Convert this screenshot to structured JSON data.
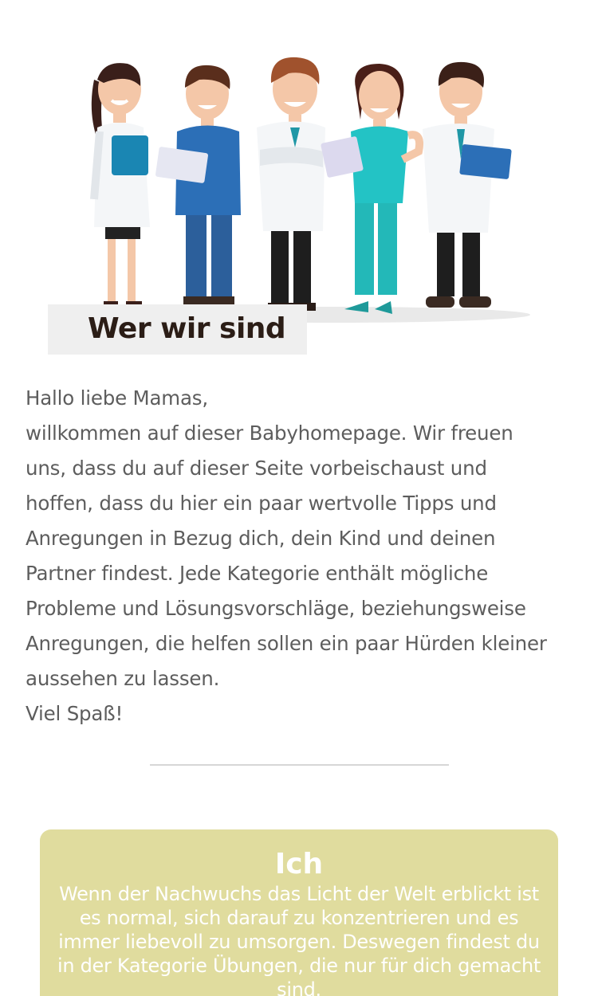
{
  "header": {
    "title": "Wer wir sind"
  },
  "intro": {
    "greeting": "Hallo liebe Mamas,",
    "body": "willkommen auf dieser Babyhomepage. Wir freuen uns, dass du auf dieser Seite vorbeischaust und hoffen, dass du hier ein paar wertvolle Tipps und Anregungen in Bezug dich, dein Kind und deinen Partner findest. Jede Kategorie enthält mögliche Probleme und Lösungsvorschläge, beziehungsweise Anregungen, die helfen sollen ein paar Hürden kleiner aussehen zu lassen.",
    "closing": "Viel Spaß!"
  },
  "card": {
    "title": "Ich",
    "text": "Wenn der Nachwuchs das Licht der Welt erblickt ist es normal, sich darauf zu konzentrieren und es immer liebevoll zu umsorgen. Deswegen findest du in der Kategorie Übungen, die nur für dich gemacht sind."
  },
  "colors": {
    "title_bg": "#efefef",
    "title_text": "#2b1d16",
    "body_text": "#5d5d5d",
    "card_bg": "#e0dc9e",
    "card_text": "#ffffff"
  },
  "icons": {
    "hero": "medical-team-illustration"
  }
}
